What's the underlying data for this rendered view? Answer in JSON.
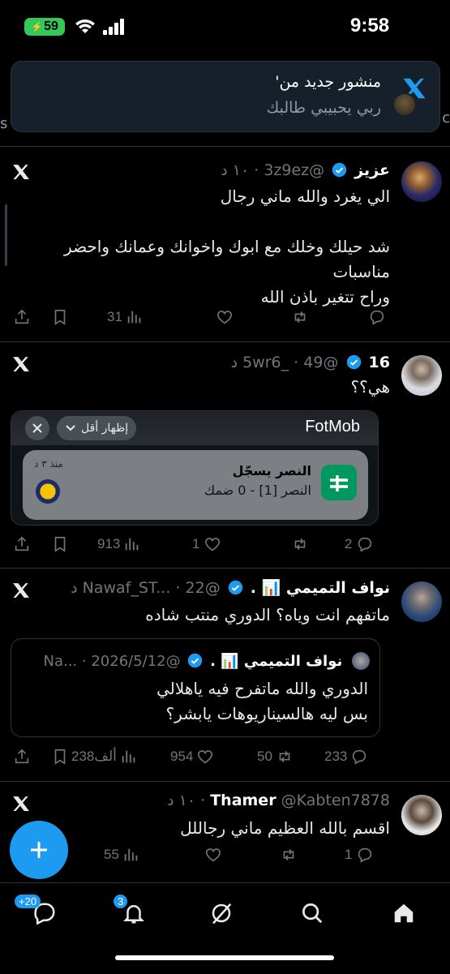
{
  "status_bar": {
    "time": "9:58",
    "battery": "59"
  },
  "banner": {
    "title": "منشور جديد من'",
    "body": "ربي يحبيبي طالبك"
  },
  "header": {
    "left_edge": "s",
    "right_edge": "c"
  },
  "tweets": [
    {
      "name": "عزيز",
      "handle": "@3z9ez",
      "time": "١٠ د",
      "text_lines": [
        "الي يغرد والله ماني رجال",
        "",
        "شد حيلك وخلك مع ابوك واخوانك وعمانك واحضر",
        "مناسبات",
        "وراح تتغير باذن الله"
      ],
      "replies": "",
      "retweets": "",
      "likes": "",
      "views": "31"
    },
    {
      "name": "16",
      "handle": "@5wr6_",
      "time": "49 د",
      "text_lines": [
        "هي؟؟"
      ],
      "replies": "2",
      "retweets": "",
      "likes": "1",
      "views": "913",
      "card": {
        "app": "FotMob",
        "show_less": "إظهار أقل",
        "title": "النصر يسجّل",
        "score": "النصر [1] - 0 ضمك",
        "ago": "منذ ٣ د"
      }
    },
    {
      "name": "نواف التميمي 📊 .",
      "handle": "@Nawaf_ST...",
      "time": "22 د",
      "text_lines": [
        "ماتفهم انت وياه؟ الدوري منتب شاده"
      ],
      "replies": "233",
      "retweets": "50",
      "likes": "954",
      "views": "238ألف",
      "quote": {
        "name": "نواف التميمي 📊 .",
        "handle": "@Na...",
        "date": "2026/5/12",
        "text_lines": [
          "الدوري والله ماتفرح فيه ياهلالي",
          "بس ليه هالسيناريوهات يابشر؟"
        ]
      }
    },
    {
      "name": "Thamer",
      "handle": "@Kabten7878",
      "time": "١٠ د",
      "text_lines": [
        "اقسم بالله العظيم ماني رجاللل"
      ],
      "replies": "1",
      "retweets": "",
      "likes": "",
      "views": "55"
    }
  ],
  "tabbar": {
    "messages_badge": "+20",
    "notifications_badge": "3"
  },
  "colors": {
    "accent": "#1d9bf0",
    "background": "#000000",
    "muted": "#71767b"
  }
}
